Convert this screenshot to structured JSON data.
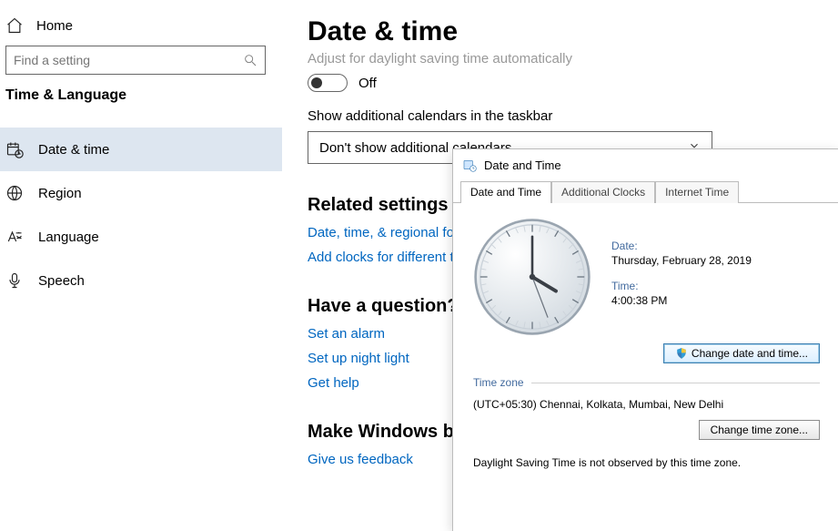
{
  "sidebar": {
    "home": "Home",
    "search_placeholder": "Find a setting",
    "section": "Time & Language",
    "items": [
      {
        "label": "Date & time"
      },
      {
        "label": "Region"
      },
      {
        "label": "Language"
      },
      {
        "label": "Speech"
      }
    ]
  },
  "main": {
    "title": "Date & time",
    "dst_label": "Adjust for daylight saving time automatically",
    "toggle_state": "Off",
    "calendars_label": "Show additional calendars in the taskbar",
    "calendars_value": "Don't show additional calendars",
    "related_head": "Related settings",
    "related_links": [
      "Date, time, & regional fo",
      "Add clocks for different t"
    ],
    "question_head": "Have a question?",
    "question_links": [
      "Set an alarm",
      "Set up night light",
      "Get help"
    ],
    "better_head": "Make Windows be",
    "better_links": [
      "Give us feedback"
    ]
  },
  "dialog": {
    "title": "Date and Time",
    "tabs": [
      "Date and Time",
      "Additional Clocks",
      "Internet Time"
    ],
    "date_lbl": "Date:",
    "date_val": "Thursday, February 28, 2019",
    "time_lbl": "Time:",
    "time_val": "4:00:38 PM",
    "change_dt_btn": "Change date and time...",
    "tz_head": "Time zone",
    "tz_val": "(UTC+05:30) Chennai, Kolkata, Mumbai, New Delhi",
    "change_tz_btn": "Change time zone...",
    "dst_note": "Daylight Saving Time is not observed by this time zone."
  }
}
